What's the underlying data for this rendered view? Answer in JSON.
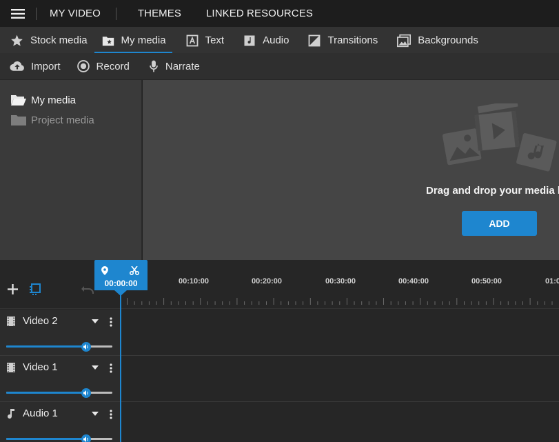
{
  "topbar": {
    "title": "MY VIDEO",
    "links": [
      "THEMES",
      "LINKED RESOURCES"
    ]
  },
  "tabs": [
    {
      "label": "Stock media",
      "icon": "star-icon"
    },
    {
      "label": "My media",
      "icon": "folder-star-icon",
      "active": true
    },
    {
      "label": "Text",
      "icon": "text-icon"
    },
    {
      "label": "Audio",
      "icon": "music-note-icon"
    },
    {
      "label": "Transitions",
      "icon": "transition-icon"
    },
    {
      "label": "Backgrounds",
      "icon": "backgrounds-icon"
    }
  ],
  "actions": [
    {
      "label": "Import",
      "icon": "cloud-upload-icon"
    },
    {
      "label": "Record",
      "icon": "record-icon"
    },
    {
      "label": "Narrate",
      "icon": "microphone-icon"
    }
  ],
  "sidebar": {
    "folders": [
      {
        "label": "My media",
        "active": true
      },
      {
        "label": "Project media",
        "active": false
      }
    ]
  },
  "media": {
    "drop_text": "Drag and drop your media he",
    "add_label": "ADD"
  },
  "timeline": {
    "playhead_time": "00:00:00",
    "ticks": [
      "00:10:00",
      "00:20:00",
      "00:30:00",
      "00:40:00",
      "00:50:00",
      "01:0"
    ],
    "tracks": [
      {
        "name": "Video 2",
        "icon": "film-icon",
        "volume": 0.75
      },
      {
        "name": "Video 1",
        "icon": "film-icon",
        "volume": 0.75
      },
      {
        "name": "Audio 1",
        "icon": "music-note-icon",
        "volume": 0.75
      }
    ]
  },
  "colors": {
    "accent": "#1e86cf",
    "topbar": "#1d1d1d",
    "tabs": "#333333",
    "media_area": "#454545"
  }
}
